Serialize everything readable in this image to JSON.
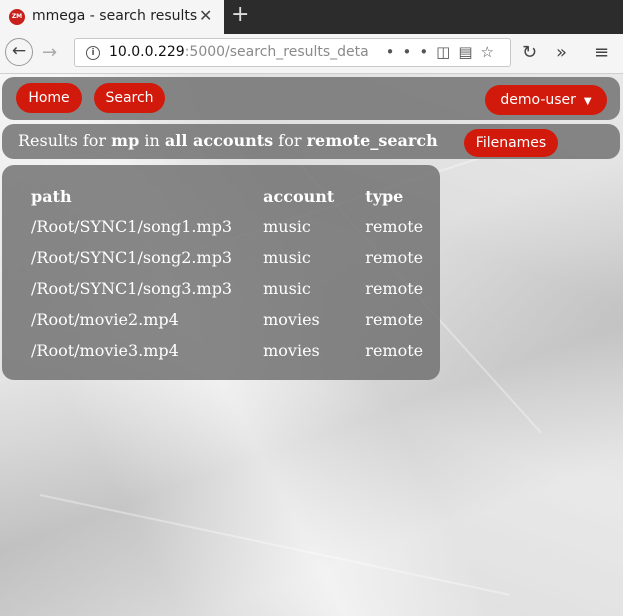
{
  "browser": {
    "tab_title": "mmega - search results",
    "favicon_text": "ZM",
    "url_host": "10.0.0.229",
    "url_rest": ":5000/search_results_detail",
    "icons": [
      "back-arrow-icon",
      "forward-arrow-icon",
      "info-icon",
      "more-dots-icon",
      "pocket-icon",
      "reader-icon",
      "star-icon",
      "reload-icon",
      "overflow-icon",
      "hamburger-menu-icon"
    ]
  },
  "nav": {
    "home_label": "Home",
    "search_label": "Search",
    "user_label": "demo-user"
  },
  "results": {
    "prefix": "Results for",
    "term": "mp",
    "in_word": "in",
    "scope": "all accounts",
    "for_word": "for",
    "mode": "remote_search",
    "filenames_label": "Filenames"
  },
  "table": {
    "headers": [
      "path",
      "account",
      "type"
    ],
    "rows": [
      [
        "/Root/SYNC1/song1.mp3",
        "music",
        "remote"
      ],
      [
        "/Root/SYNC1/song2.mp3",
        "music",
        "remote"
      ],
      [
        "/Root/SYNC1/song3.mp3",
        "music",
        "remote"
      ],
      [
        "/Root/movie2.mp4",
        "movies",
        "remote"
      ],
      [
        "/Root/movie3.mp4",
        "movies",
        "remote"
      ]
    ]
  },
  "colors": {
    "accent": "#d11a0c",
    "panel": "#6e6e6e"
  }
}
